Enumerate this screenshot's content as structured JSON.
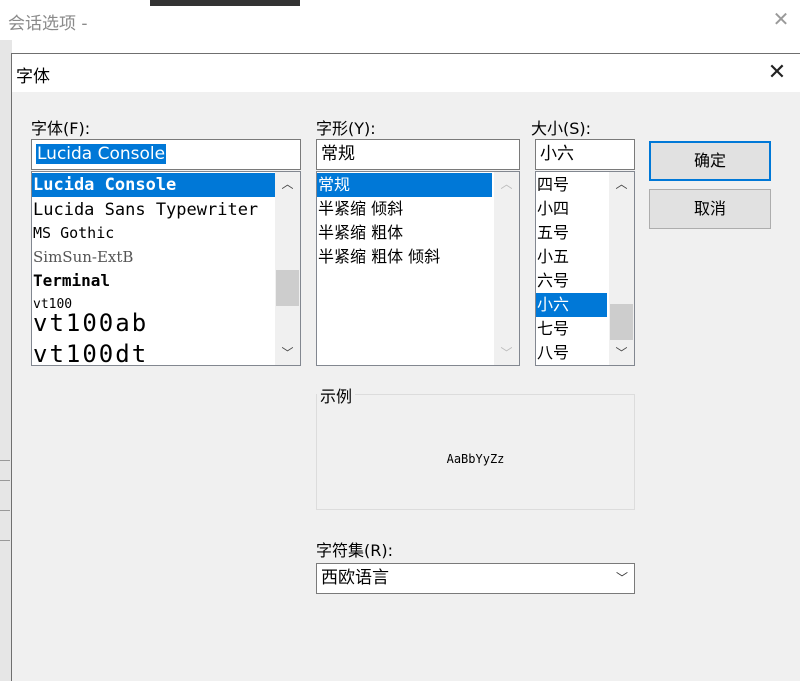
{
  "background_window": {
    "title": "会话选项 -"
  },
  "dialog": {
    "title": "字体",
    "font": {
      "label": "字体(F):",
      "value": "Lucida Console",
      "items": [
        {
          "text": "Lucida Console",
          "selected": true
        },
        {
          "text": "Lucida Sans Typewriter",
          "selected": false
        },
        {
          "text": "MS Gothic",
          "selected": false
        },
        {
          "text": "SimSun-ExtB",
          "selected": false
        },
        {
          "text": "Terminal",
          "selected": false
        },
        {
          "text": "vt100",
          "selected": false
        },
        {
          "text": "vt100ab",
          "selected": false
        },
        {
          "text": "vt100dt",
          "selected": false
        }
      ]
    },
    "style": {
      "label": "字形(Y):",
      "value": "常规",
      "items": [
        {
          "text": "常规",
          "selected": true
        },
        {
          "text": "半紧缩 倾斜",
          "selected": false
        },
        {
          "text": "半紧缩 粗体",
          "selected": false
        },
        {
          "text": "半紧缩 粗体 倾斜",
          "selected": false
        }
      ]
    },
    "size": {
      "label": "大小(S):",
      "value": "小六",
      "items": [
        {
          "text": "四号",
          "selected": false
        },
        {
          "text": "小四",
          "selected": false
        },
        {
          "text": "五号",
          "selected": false
        },
        {
          "text": "小五",
          "selected": false
        },
        {
          "text": "六号",
          "selected": false
        },
        {
          "text": "小六",
          "selected": true
        },
        {
          "text": "七号",
          "selected": false
        },
        {
          "text": "八号",
          "selected": false
        }
      ]
    },
    "ok_label": "确定",
    "cancel_label": "取消",
    "sample": {
      "legend": "示例",
      "text": "AaBbYyZz"
    },
    "charset": {
      "label": "字符集(R):",
      "value": "西欧语言"
    }
  }
}
